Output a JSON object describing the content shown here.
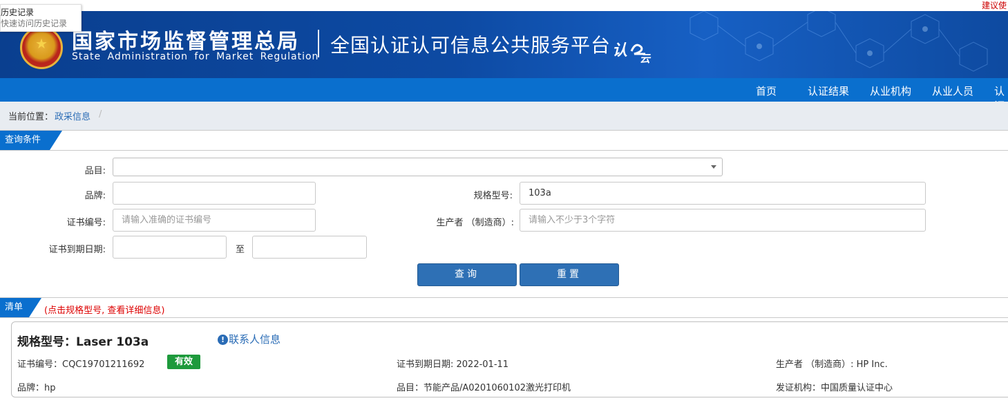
{
  "top": {
    "suggest": "建议使"
  },
  "history": {
    "title": "历史记录",
    "subtitle": "快速访问历史记录"
  },
  "banner": {
    "title_cn": "国家市场监督管理总局",
    "title_en": "State Administration  for  Market Regulation",
    "platform": "全国认证认可信息公共服务平台",
    "logo_text": "认云"
  },
  "nav": {
    "items": [
      "首页",
      "认证结果",
      "从业机构",
      "从业人员",
      "认证"
    ]
  },
  "breadcrumb": {
    "label": "当前位置：",
    "link": "政采信息",
    "sep": "/"
  },
  "query": {
    "section_title": "查询条件",
    "fields": {
      "category_label": "品目:",
      "brand_label": "品牌:",
      "brand_value": "",
      "model_label": "规格型号:",
      "model_value": "103a",
      "cert_no_label": "证书编号:",
      "cert_no_placeholder": "请输入准确的证书编号",
      "maker_label": "生产者 （制造商）:",
      "maker_placeholder": "请输入不少于3个字符",
      "expiry_label": "证书到期日期:",
      "expiry_to": "至"
    },
    "buttons": {
      "search": "查询",
      "reset": "重置"
    }
  },
  "list": {
    "section_title": "清单",
    "hint": "(点击规格型号, 查看详细信息)",
    "card": {
      "model": "规格型号：Laser 103a",
      "contact": "联系人信息",
      "cert_no": "证书编号：CQC19701211692",
      "status": "有效",
      "expiry": "证书到期日期: 2022-01-11",
      "maker": "生产者 （制造商）: HP Inc.",
      "brand": "品牌：hp",
      "category": "品目：节能产品/A0201060102激光打印机",
      "issuer": "发证机构：中国质量认证中心"
    }
  },
  "colors": {
    "nav": "#0a6fce",
    "banner": "#0d4aa3",
    "button": "#2e70b5",
    "valid": "#1e9a3c",
    "hint": "#dd0000"
  }
}
